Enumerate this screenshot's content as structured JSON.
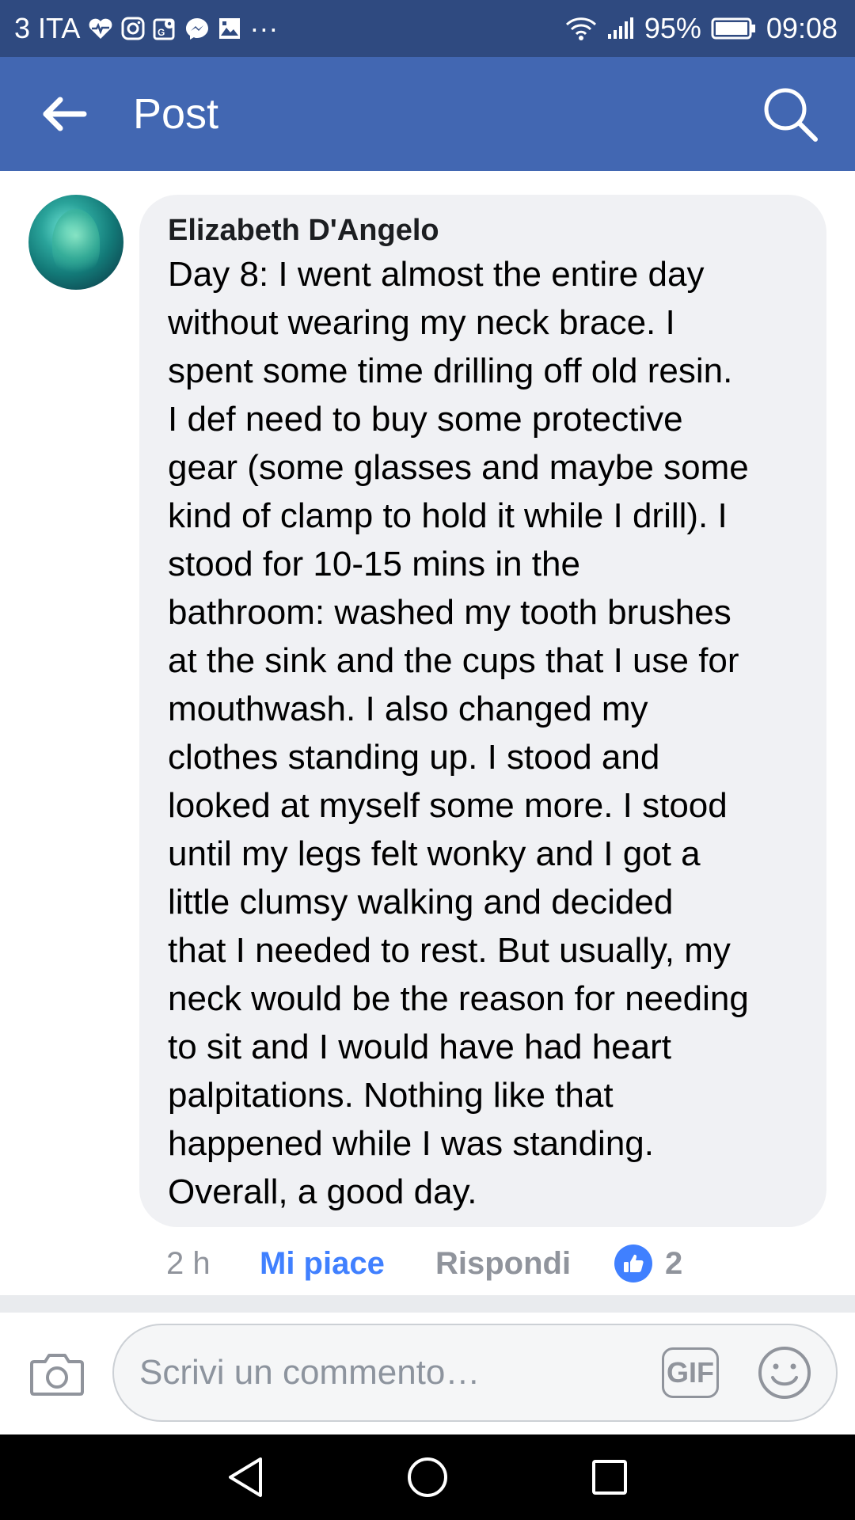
{
  "status_bar": {
    "carrier": "3 ITA",
    "more": "···",
    "battery": "95%",
    "time": "09:08",
    "icons": [
      "heart-monitor-icon",
      "instagram-icon",
      "maps-icon",
      "messenger-icon",
      "gallery-icon",
      "wifi-icon",
      "signal-icon",
      "battery-icon"
    ]
  },
  "app_bar": {
    "title": "Post",
    "icons": [
      "back-arrow-icon",
      "search-icon"
    ]
  },
  "comment": {
    "author": "Elizabeth D'Angelo",
    "text": "Day 8: I went almost the entire day\nwithout wearing my neck brace.  I\nspent some time drilling off old resin.\nI def need to buy some protective\ngear (some glasses and maybe some\nkind of clamp to hold it while I drill).  I\nstood for 10-15 mins in the\nbathroom: washed my tooth brushes\nat the sink and the cups that I use for\nmouthwash.  I also changed my\nclothes standing up.  I stood and\nlooked at myself some more.  I stood\nuntil my legs felt wonky and I got a\nlittle clumsy walking and decided\nthat I needed to rest.  But usually, my\nneck would be the reason for needing\nto sit and I would have had heart\npalpitations.  Nothing like that\nhappened while I was standing.\nOverall, a good day.",
    "time": "2 h",
    "like_label": "Mi piace",
    "reply_label": "Rispondi",
    "reaction_count": "2"
  },
  "composer": {
    "placeholder": "Scrivi un commento…",
    "gif_label": "GIF"
  },
  "colors": {
    "status_bar": "#2f4a80",
    "app_bar": "#4267b2",
    "accent": "#4080ff",
    "bubble": "#f0f1f4",
    "muted": "#90949c"
  }
}
